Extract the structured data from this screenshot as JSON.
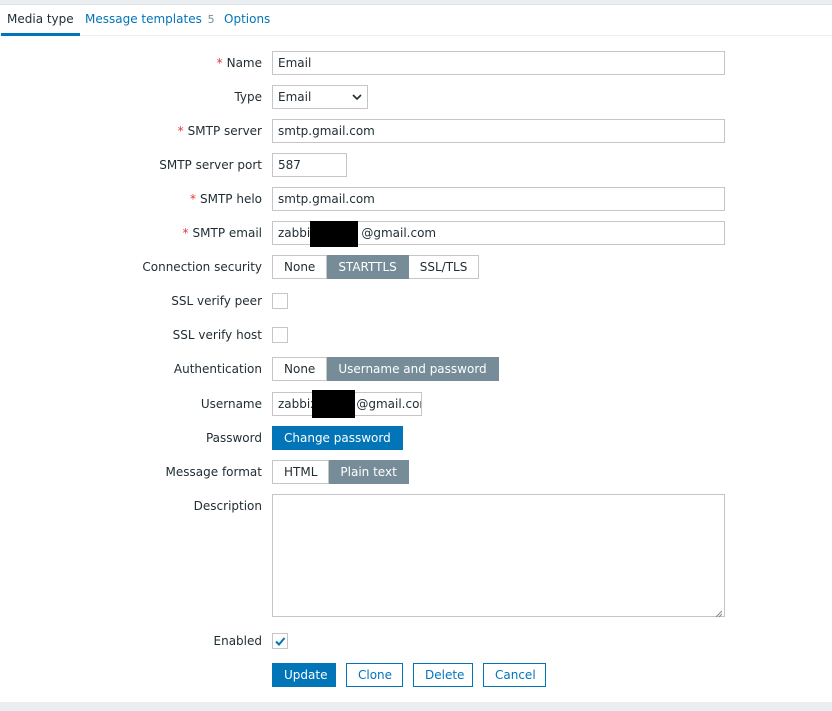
{
  "tabs": [
    {
      "label": "Media type"
    },
    {
      "label": "Message templates",
      "count": "5"
    },
    {
      "label": "Options"
    }
  ],
  "form": {
    "name": {
      "label": "Name",
      "value": "Email"
    },
    "type": {
      "label": "Type",
      "value": "Email"
    },
    "smtp_server": {
      "label": "SMTP server",
      "value": "smtp.gmail.com"
    },
    "smtp_port": {
      "label": "SMTP server port",
      "value": "587"
    },
    "smtp_helo": {
      "label": "SMTP helo",
      "value": "smtp.gmail.com"
    },
    "smtp_email": {
      "label": "SMTP email",
      "value_prefix": "zabbix",
      "value_suffix": "@gmail.com"
    },
    "connection_security": {
      "label": "Connection security",
      "options": [
        "None",
        "STARTTLS",
        "SSL/TLS"
      ],
      "selected": "STARTTLS"
    },
    "ssl_verify_peer": {
      "label": "SSL verify peer",
      "checked": false
    },
    "ssl_verify_host": {
      "label": "SSL verify host",
      "checked": false
    },
    "authentication": {
      "label": "Authentication",
      "options": [
        "None",
        "Username and password"
      ],
      "selected": "Username and password"
    },
    "username": {
      "label": "Username",
      "value_prefix": "zabbix",
      "value_suffix": "@gmail.cor"
    },
    "password": {
      "label": "Password",
      "button": "Change password"
    },
    "message_format": {
      "label": "Message format",
      "options": [
        "HTML",
        "Plain text"
      ],
      "selected": "Plain text"
    },
    "description": {
      "label": "Description",
      "value": ""
    },
    "enabled": {
      "label": "Enabled",
      "checked": true
    }
  },
  "actions": {
    "update": "Update",
    "clone": "Clone",
    "delete": "Delete",
    "cancel": "Cancel"
  },
  "colors": {
    "accent": "#0275b8",
    "selected_segment": "#768d99",
    "required": "#e33734"
  }
}
